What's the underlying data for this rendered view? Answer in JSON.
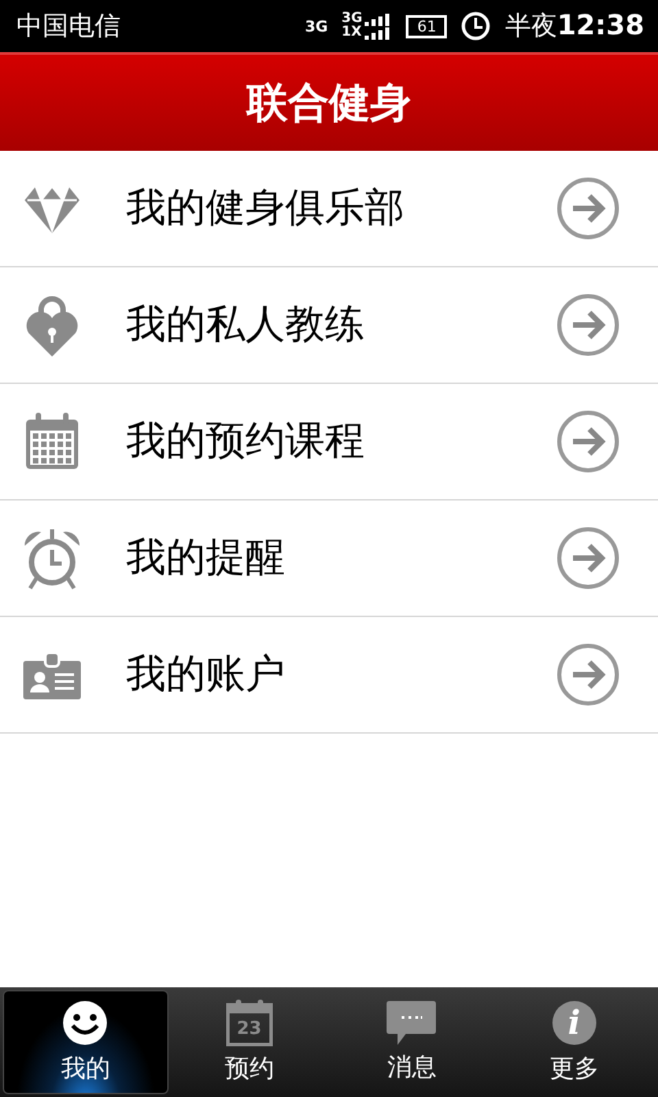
{
  "status_bar": {
    "carrier": "中国电信",
    "network": "3G",
    "data_types": [
      "3G",
      "1X"
    ],
    "battery": "61",
    "time_period": "半夜",
    "time": "12:38"
  },
  "header": {
    "title": "联合健身"
  },
  "menu": [
    {
      "kind": "diamond",
      "label": "我的健身俱乐部"
    },
    {
      "kind": "lock",
      "label": "我的私人教练"
    },
    {
      "kind": "calendar",
      "label": "我的预约课程"
    },
    {
      "kind": "alarm",
      "label": "我的提醒"
    },
    {
      "kind": "card",
      "label": "我的账户"
    }
  ],
  "tabs": [
    {
      "kind": "smiley",
      "label": "我的",
      "selected": true
    },
    {
      "kind": "calendar",
      "icon_text": "23",
      "label": "预约",
      "selected": false
    },
    {
      "kind": "chat",
      "label": "消息",
      "selected": false
    },
    {
      "kind": "info",
      "icon_text": "i",
      "label": "更多",
      "selected": false
    }
  ]
}
